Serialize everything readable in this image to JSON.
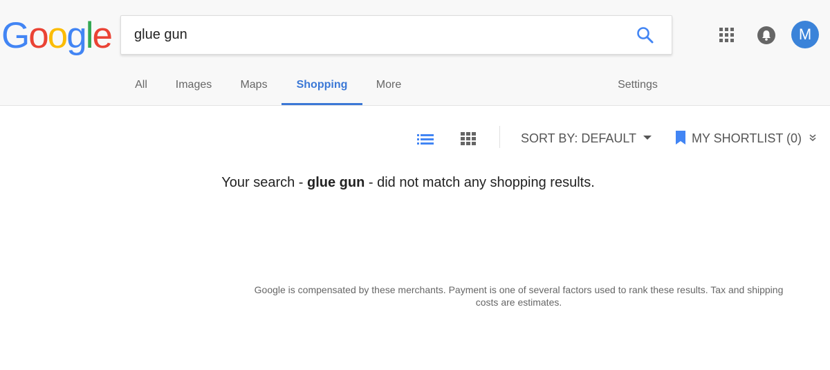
{
  "logo": {
    "letters": [
      "G",
      "o",
      "o",
      "g",
      "l",
      "e"
    ],
    "colors": [
      "#4285f4",
      "#ea4335",
      "#fbbc05",
      "#4285f4",
      "#34a853",
      "#ea4335"
    ]
  },
  "search": {
    "query": "glue gun",
    "icon": "search-icon",
    "icon_color": "#4285f4"
  },
  "header_icons": {
    "apps": "apps-grid-icon",
    "notifications": "bell-icon",
    "avatar_letter": "M",
    "avatar_color": "#3b83d9"
  },
  "tabs": [
    {
      "label": "All",
      "active": false
    },
    {
      "label": "Images",
      "active": false
    },
    {
      "label": "Maps",
      "active": false
    },
    {
      "label": "Shopping",
      "active": true
    },
    {
      "label": "More",
      "active": false
    }
  ],
  "settings_label": "Settings",
  "accent_color": "#3b78d6",
  "toolbar": {
    "list_view_icon": "list-view-icon",
    "grid_view_icon": "grid-view-icon",
    "sort_label": "SORT BY: DEFAULT",
    "shortlist_label": "MY SHORTLIST (0)",
    "bookmark_icon": "bookmark-icon",
    "expand_icon": "chevron-double-down-icon"
  },
  "message": {
    "prefix": "Your search - ",
    "query": "glue gun",
    "suffix": " - did not match any shopping results."
  },
  "disclaimer": "Google is compensated by these merchants. Payment is one of several factors used to rank these results. Tax and shipping costs are estimates."
}
